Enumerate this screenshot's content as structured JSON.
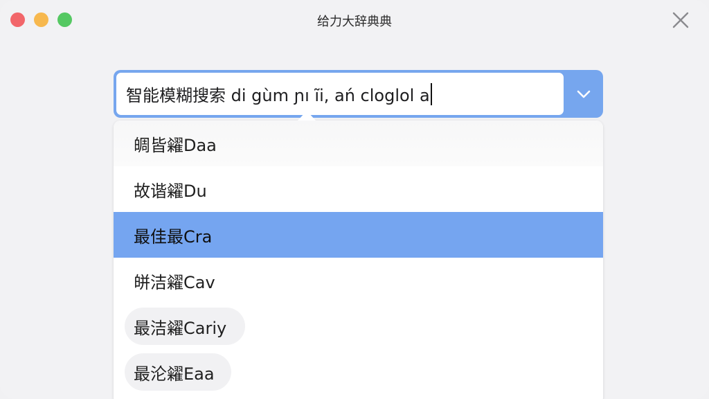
{
  "window": {
    "title": "给力大辞典典"
  },
  "search": {
    "value": "智能模糊搜索  di  gùm ɲı ĩi,  ań   cloglol  a"
  },
  "results": [
    {
      "label": "皗皆糴Daa"
    },
    {
      "label": "故谐糴Du"
    },
    {
      "label": "最佳最Cra"
    },
    {
      "label": "皏洁糴Cav"
    },
    {
      "label": "最洁糴Cariy"
    },
    {
      "label": "最沦糴Eaa"
    }
  ],
  "selected_index": 2,
  "colors": {
    "accent": "#76a6ee",
    "selected_row": "#75a5f0",
    "close_red": "#f2666a",
    "minimize_yellow": "#f7b84e",
    "zoom_green": "#55c862"
  },
  "icons": {
    "close": "x-icon",
    "dropdown": "chevron-down-icon"
  }
}
